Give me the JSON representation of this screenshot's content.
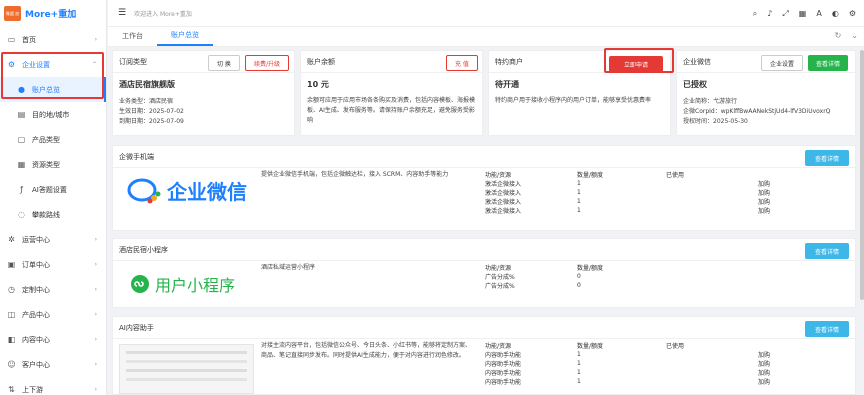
{
  "app": {
    "logo_mark": "微盟 加",
    "title": "More+重加"
  },
  "sidebar": {
    "items": [
      {
        "label": "首页",
        "icon": "monitor-icon",
        "chevron": "›"
      },
      {
        "label": "企业设置",
        "icon": "gear-icon",
        "chevron": "⌃"
      },
      {
        "label": "账户总览",
        "icon": "circle-icon"
      },
      {
        "label": "目的地/城市",
        "icon": "map-icon"
      },
      {
        "label": "产品类型",
        "icon": "box-icon"
      },
      {
        "label": "资源类型",
        "icon": "grid-icon"
      },
      {
        "label": "AI答题设置",
        "icon": "fx-icon"
      },
      {
        "label": "攀款路线",
        "icon": "route-icon"
      },
      {
        "label": "运营中心",
        "icon": "settings-icon",
        "chevron": "›"
      },
      {
        "label": "订单中心",
        "icon": "order-icon",
        "chevron": "›"
      },
      {
        "label": "定制中心",
        "icon": "clock-icon",
        "chevron": "›"
      },
      {
        "label": "产品中心",
        "icon": "product-icon",
        "chevron": "›"
      },
      {
        "label": "内容中心",
        "icon": "content-icon",
        "chevron": "›"
      },
      {
        "label": "客户中心",
        "icon": "customer-icon",
        "chevron": "›"
      },
      {
        "label": "上下游",
        "icon": "chain-icon",
        "chevron": "›"
      }
    ]
  },
  "topbar": {
    "welcome": "欢迎进入 More+重加"
  },
  "tabs": [
    {
      "label": "工作台"
    },
    {
      "label": "账户总览"
    }
  ],
  "cards": {
    "subscription": {
      "header": "订阅类型",
      "switch": "切 换",
      "renew": "续费/升级",
      "title": "酒店民宿旗舰版",
      "lines": [
        "业务类型：酒店民宿",
        "生效日期：2025-07-02",
        "到期日期：2025-07-09"
      ]
    },
    "balance": {
      "header": "账户余额",
      "recharge": "充 值",
      "title": "10 元",
      "desc": "余额可应用于应用市场各条购买及消费，包括内容模板、海报模板、AI生成、发布服务等。请保持账户余额充足，避免服务受影响"
    },
    "merchant": {
      "header": "特约商户",
      "apply": "立即申请",
      "title": "待开通",
      "desc": "特约商户用于接收小程序内的用户订单，能够享受优惠费率"
    },
    "wecom": {
      "header": "企业微信",
      "settings": "企业设置",
      "detail": "查看详情",
      "title": "已授权",
      "lines": [
        "企业简称：弋游旅行",
        "企微CorpId：wpKlffBwAANekStjUd4-lfV3DiUvoxrQ",
        "授权时间：2025-05-30"
      ]
    }
  },
  "sections": [
    {
      "title": "企微手机端",
      "logo_text": "企业微信",
      "desc": "提供企业微信手机端，包括企微触达栏，接入 SCRM、内容助手等能力",
      "button": "查看详情",
      "headers": [
        "功能/资源",
        "数量/额度",
        "已使用",
        ""
      ],
      "rows": [
        [
          "激活企微接入",
          "1",
          "",
          "加购"
        ],
        [
          "激活企微接入",
          "1",
          "",
          "加购"
        ],
        [
          "激活企微接入",
          "1",
          "",
          "加购"
        ],
        [
          "激活企微接入",
          "1",
          "",
          "加购"
        ]
      ]
    },
    {
      "title": "酒店民宿小程序",
      "logo_text": "用户小程序",
      "desc": "酒店私域运营小程序",
      "button": "查看详情",
      "headers": [
        "功能/资源",
        "数量/额度",
        "",
        ""
      ],
      "rows": [
        [
          "广告分成%",
          "0",
          "",
          ""
        ],
        [
          "广告分成%",
          "0",
          "",
          ""
        ]
      ]
    },
    {
      "title": "AI内容助手",
      "desc": "对接主流内容平台，包括微信公众号、今日头条、小红书等，能够将定制方案、商品、笔记直接同步发布。同时提供AI生成能力，便于对内容进行润色修改。",
      "button": "查看详情",
      "headers": [
        "功能/资源",
        "数量/额度",
        "已使用",
        ""
      ],
      "rows": [
        [
          "内容助手功能",
          "1",
          "",
          "加购"
        ],
        [
          "内容助手功能",
          "1",
          "",
          "加购"
        ],
        [
          "内容助手功能",
          "1",
          "",
          "加购"
        ],
        [
          "内容助手功能",
          "1",
          "",
          "加购"
        ]
      ]
    }
  ]
}
